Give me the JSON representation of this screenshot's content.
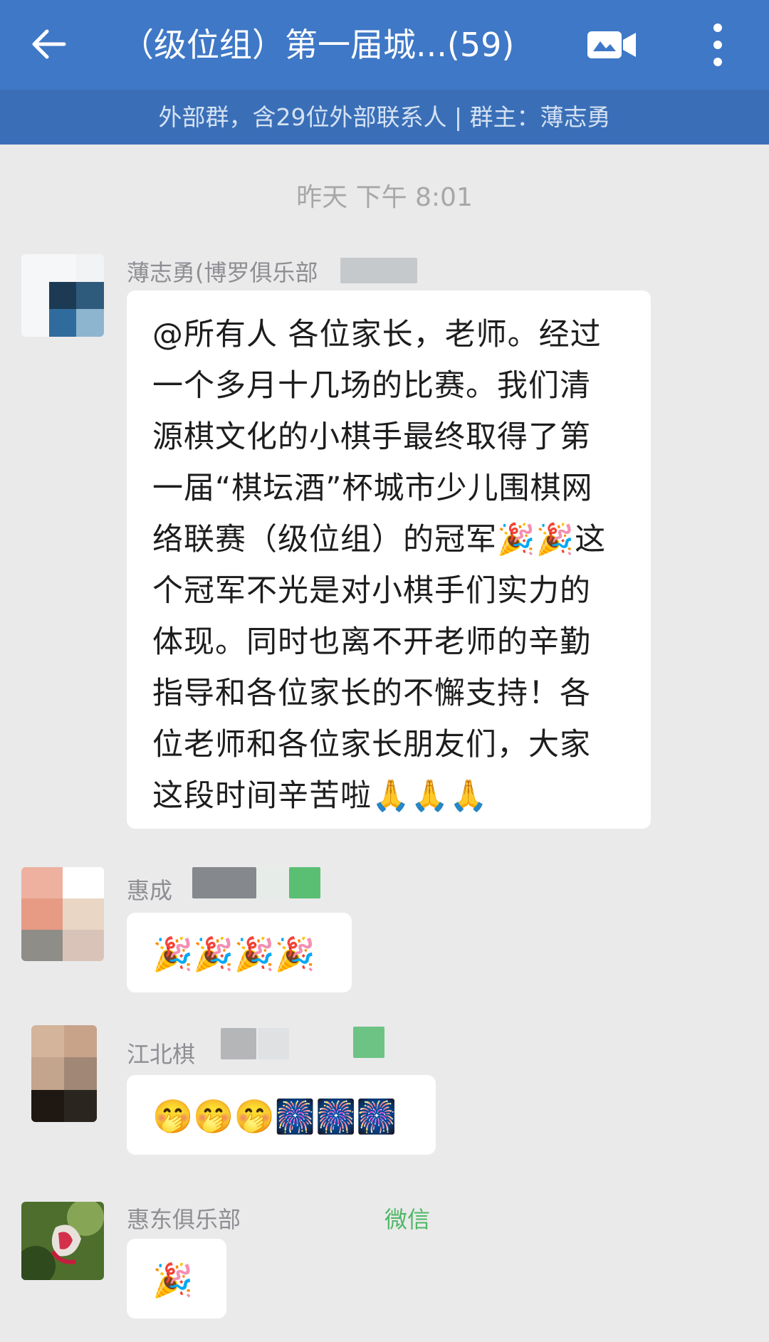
{
  "header": {
    "title": "（级位组）第一届城...(59)",
    "subtitle": "外部群，含29位外部联系人 | 群主：薄志勇"
  },
  "chat": {
    "timestamp": "昨天  下午 8:01",
    "messages": [
      {
        "sender": "薄志勇(博罗俱乐部",
        "text": "@所有人 各位家长，老师。经过一个多月十几场的比赛。我们清源棋文化的小棋手最终取得了第一届“棋坛酒”杯城市少儿围棋网络联赛（级位组）的冠军🎉🎉这个冠军不光是对小棋手们实力的体现。同时也离不开老师的辛勤指导和各位家长的不懈支持！各位老师和各位家长朋友们，大家这段时间辛苦啦🙏🙏🙏"
      },
      {
        "sender": "惠成",
        "text": "🎉🎉🎉🎉"
      },
      {
        "sender": "江北棋",
        "text": "🤭🤭🤭🎆🎆🎆"
      },
      {
        "sender": "惠东俱乐部",
        "sender_suffix": "微信",
        "text": "🎉"
      }
    ]
  },
  "colors": {
    "header_bg": "#3f78c6",
    "subheader_bg": "#3a6fb8",
    "chat_bg": "#eaeaeb",
    "bubble_bg": "#ffffff",
    "wechat_green": "#4fb765"
  },
  "icons": [
    "back-arrow-icon",
    "video-call-icon",
    "more-vertical-icon"
  ]
}
